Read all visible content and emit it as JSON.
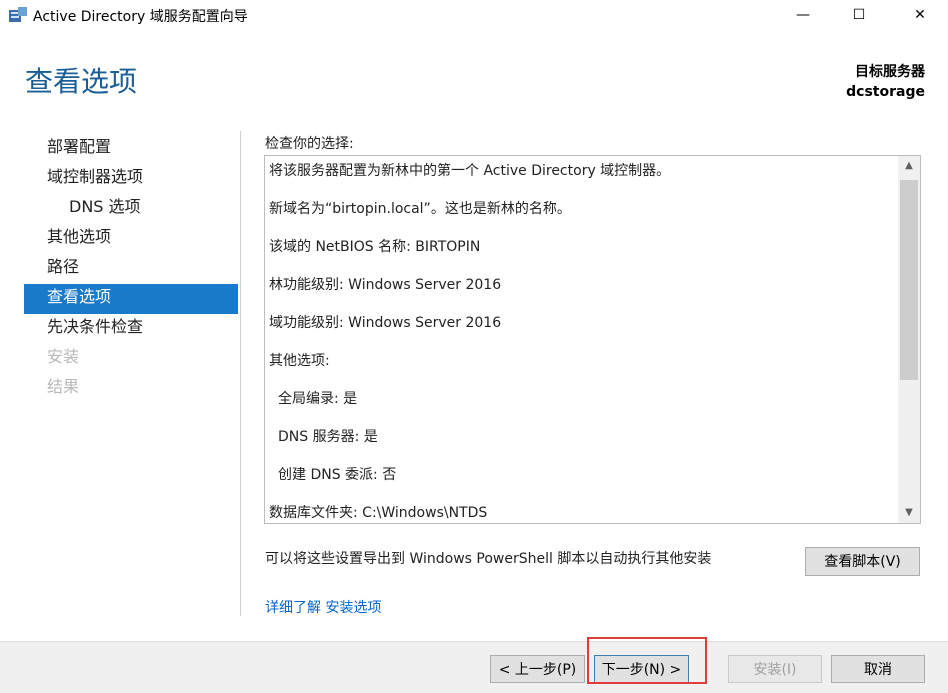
{
  "window": {
    "title": "Active Directory 域服务配置向导",
    "minimize_glyph": "—",
    "maximize_glyph": "☐",
    "close_glyph": "✕"
  },
  "header": {
    "page_title": "查看选项",
    "target_server_label": "目标服务器",
    "target_server_name": "dcstorage"
  },
  "nav": {
    "items": [
      {
        "label": "部署配置",
        "state": "normal"
      },
      {
        "label": "域控制器选项",
        "state": "normal"
      },
      {
        "label": "DNS 选项",
        "state": "normal"
      },
      {
        "label": "其他选项",
        "state": "normal"
      },
      {
        "label": "路径",
        "state": "normal"
      },
      {
        "label": "查看选项",
        "state": "active"
      },
      {
        "label": "先决条件检查",
        "state": "normal"
      },
      {
        "label": "安装",
        "state": "disabled"
      },
      {
        "label": "结果",
        "state": "disabled"
      }
    ]
  },
  "review": {
    "label": "检查你的选择:",
    "lines": [
      "将该服务器配置为新林中的第一个 Active Directory 域控制器。",
      "新域名为“birtopin.local”。这也是新林的名称。",
      "该域的 NetBIOS 名称: BIRTOPIN",
      "林功能级别: Windows Server 2016",
      "域功能级别: Windows Server 2016",
      "其他选项:",
      "全局编录: 是",
      "DNS 服务器: 是",
      "创建 DNS 委派: 否",
      "数据库文件夹: C:\\Windows\\NTDS"
    ]
  },
  "export": {
    "text": "可以将这些设置导出到 Windows PowerShell 脚本以自动执行其他安装",
    "view_script_button": "查看脚本(V)"
  },
  "more_link": "详细了解 安装选项",
  "footer": {
    "prev_button": "< 上一步(P)",
    "next_button": "下一步(N) >",
    "install_button": "安装(I)",
    "cancel_button": "取消"
  },
  "colors": {
    "title_blue": "#1a5e98",
    "nav_active": "#1979ca",
    "link_blue": "#0066cc",
    "highlight_red": "#e03c3c"
  }
}
